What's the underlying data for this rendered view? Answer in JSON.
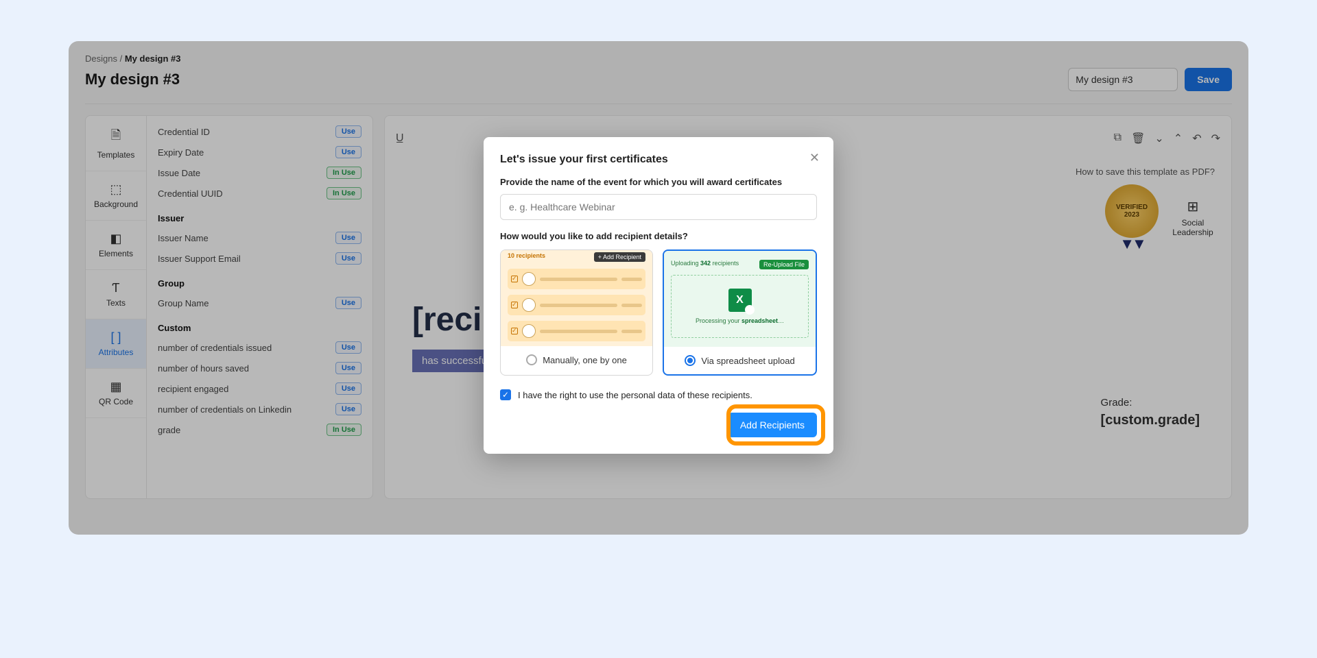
{
  "breadcrumbs": {
    "root": "Designs",
    "sep": "/",
    "current": "My design #3"
  },
  "page": {
    "title": "My design #3",
    "name_input_value": "My design #3",
    "save_label": "Save",
    "pdf_hint": "How to save this template as PDF?"
  },
  "rail": {
    "templates": "Templates",
    "background": "Background",
    "elements": "Elements",
    "texts": "Texts",
    "attributes": "Attributes",
    "qrcode": "QR Code"
  },
  "attrs": {
    "rows": [
      {
        "label": "Credential ID",
        "state": "Use"
      },
      {
        "label": "Expiry Date",
        "state": "Use"
      },
      {
        "label": "Issue Date",
        "state": "In Use"
      },
      {
        "label": "Credential UUID",
        "state": "In Use"
      }
    ],
    "issuer_header": "Issuer",
    "issuer": [
      {
        "label": "Issuer Name",
        "state": "Use"
      },
      {
        "label": "Issuer Support Email",
        "state": "Use"
      }
    ],
    "group_header": "Group",
    "group": [
      {
        "label": "Group Name",
        "state": "Use"
      }
    ],
    "custom_header": "Custom",
    "custom": [
      {
        "label": "number of credentials issued",
        "state": "Use"
      },
      {
        "label": "number of hours saved",
        "state": "Use"
      },
      {
        "label": "recipient engaged",
        "state": "Use"
      },
      {
        "label": "number of credentials on Linkedin",
        "state": "Use"
      },
      {
        "label": "grade",
        "state": "In Use"
      }
    ]
  },
  "cert": {
    "medal_top": "VERIFIED",
    "medal_year": "2023",
    "social_line1": "Social",
    "social_line2": "Leadership",
    "recipient": "[recipient.name]",
    "completed": "has successfully completed the Nonprofit Management Program",
    "grade_label": "Grade:",
    "grade_value": "[custom.grade]"
  },
  "modal": {
    "title": "Let's issue your first certificates",
    "event_label": "Provide the name of the event for which you will award certificates",
    "event_placeholder": "e. g. Healthcare Webinar",
    "method_label": "How would you like to add recipient details?",
    "manual": {
      "count": "10 recipients",
      "add_btn": "+ Add Recipient",
      "option_label": "Manually, one by one"
    },
    "sheet": {
      "uploading_prefix": "Uploading ",
      "uploading_count": "342",
      "uploading_suffix": " recipients",
      "reupload": "Re-Upload File",
      "processing_prefix": "Processing your ",
      "processing_bold": "spreadsheet",
      "processing_suffix": "…",
      "option_label": "Via spreadsheet upload"
    },
    "consent": "I have the right to use the personal data of these recipients.",
    "submit": "Add Recipients"
  }
}
